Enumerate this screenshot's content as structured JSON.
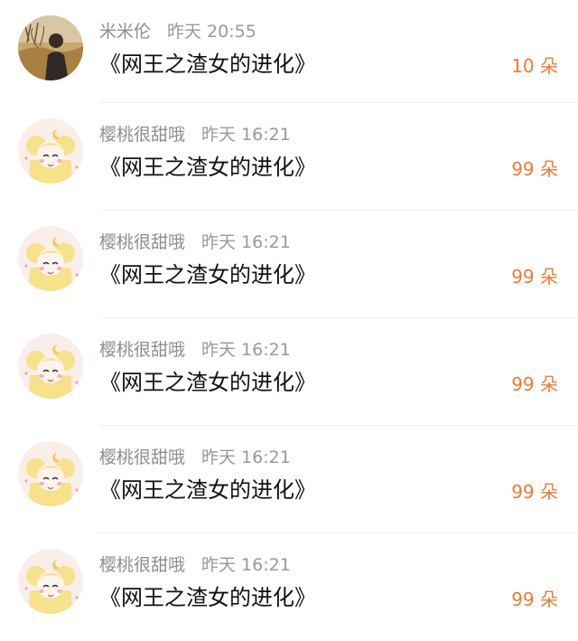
{
  "colors": {
    "accent": "#ee7b35",
    "username": "#8e8e8e",
    "title": "#111111",
    "divider": "#eeeeee"
  },
  "items": [
    {
      "avatar": "photo-avatar",
      "username": "米米伦",
      "time": "昨天 20:55",
      "title": "《网王之渣女的进化》",
      "gift": "10 朵"
    },
    {
      "avatar": "sailor-moon-avatar",
      "username": "樱桃很甜哦",
      "time": "昨天 16:21",
      "title": "《网王之渣女的进化》",
      "gift": "99 朵"
    },
    {
      "avatar": "sailor-moon-avatar",
      "username": "樱桃很甜哦",
      "time": "昨天 16:21",
      "title": "《网王之渣女的进化》",
      "gift": "99 朵"
    },
    {
      "avatar": "sailor-moon-avatar",
      "username": "樱桃很甜哦",
      "time": "昨天 16:21",
      "title": "《网王之渣女的进化》",
      "gift": "99 朵"
    },
    {
      "avatar": "sailor-moon-avatar",
      "username": "樱桃很甜哦",
      "time": "昨天 16:21",
      "title": "《网王之渣女的进化》",
      "gift": "99 朵"
    },
    {
      "avatar": "sailor-moon-avatar",
      "username": "樱桃很甜哦",
      "time": "昨天 16:21",
      "title": "《网王之渣女的进化》",
      "gift": "99 朵"
    }
  ]
}
